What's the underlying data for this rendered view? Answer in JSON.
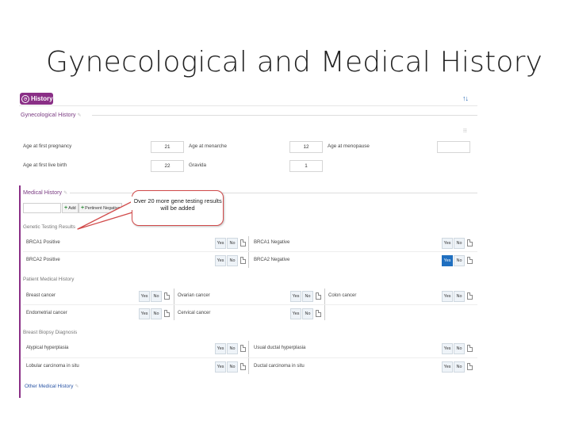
{
  "slide_title": "Gynecological and Medical History",
  "header": {
    "badge_label": "History",
    "sort_icon": "sort-arrows-icon"
  },
  "gyn": {
    "title": "Gynecological History",
    "fields": [
      {
        "label": "Age at first pregnancy",
        "value": "21"
      },
      {
        "label": "Age at menarche",
        "value": "12"
      },
      {
        "label": "Age at menopause",
        "value": ""
      },
      {
        "label": "Age at first live birth",
        "value": "22"
      },
      {
        "label": "Gravida",
        "value": "1"
      }
    ]
  },
  "medical": {
    "title": "Medical History",
    "add_label": "Add",
    "pertinent_label": "Pertinent Negative"
  },
  "callout": "Over 20 more gene testing results will be added",
  "genetic": {
    "title": "Genetic Testing Results",
    "rows": [
      {
        "left": "BRCA1 Positive",
        "right": "BRCA1 Negative"
      },
      {
        "left": "BRCA2 Positive",
        "right": "BRCA2 Negative"
      }
    ]
  },
  "patient": {
    "title": "Patient Medical History",
    "rows": [
      [
        "Breast cancer",
        "Ovarian cancer",
        "Colon cancer"
      ],
      [
        "Endometrial cancer",
        "Cervical cancer"
      ]
    ]
  },
  "biopsy": {
    "title": "Breast Biopsy Diagnosis",
    "rows": [
      {
        "left": "Atypical hyperplasia",
        "right": "Usual ductal hyperplasia"
      },
      {
        "left": "Lobular carcinoma in situ",
        "right": "Ductal carcinoma in situ"
      }
    ]
  },
  "yes": "Yes",
  "no": "No",
  "other_link": "Other Medical History"
}
